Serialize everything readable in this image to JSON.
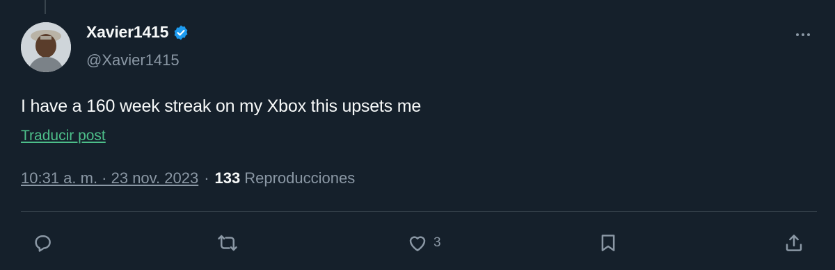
{
  "author": {
    "display_name": "Xavier1415",
    "handle": "@Xavier1415",
    "verified_icon": "verified-badge-icon",
    "verified_color": "#1d9bf0"
  },
  "tweet": {
    "text": "I have a 160 week streak on my Xbox this upsets me",
    "translate_label": "Traducir post"
  },
  "meta": {
    "time": "10:31 a. m. · 23 nov. 2023",
    "separator": "·",
    "views_count": "133",
    "views_label": "Reproducciones"
  },
  "actions": {
    "reply_icon": "reply-icon",
    "retweet_icon": "retweet-icon",
    "like_icon": "heart-icon",
    "like_count": "3",
    "bookmark_icon": "bookmark-icon",
    "share_icon": "share-icon"
  },
  "colors": {
    "background": "#15202b",
    "text": "#f7f9f9",
    "secondary": "#8b98a5",
    "link": "#4dbf8a",
    "divider": "#38444d"
  }
}
